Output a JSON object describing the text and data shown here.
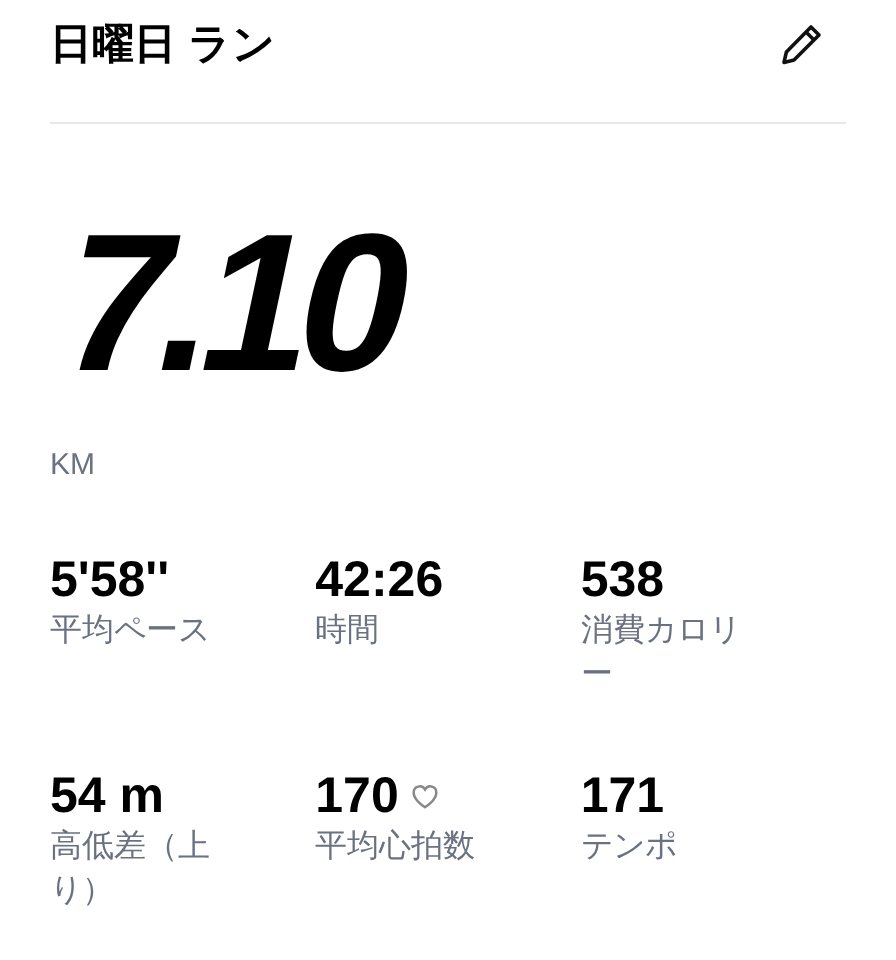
{
  "header": {
    "title": "日曜日 ラン"
  },
  "distance": {
    "value": "7.10",
    "unit": "KM"
  },
  "stats": [
    {
      "kind": "plain",
      "value": "5'58''",
      "label": "平均ペース"
    },
    {
      "kind": "plain",
      "value": "42:26",
      "label": "時間"
    },
    {
      "kind": "plain",
      "value": "538",
      "label": "消費カロリー"
    },
    {
      "kind": "plain",
      "value": "54 m",
      "label": "高低差（上り）"
    },
    {
      "kind": "heart",
      "value": "170",
      "label": "平均心拍数"
    },
    {
      "kind": "plain",
      "value": "171",
      "label": "テンポ"
    }
  ]
}
